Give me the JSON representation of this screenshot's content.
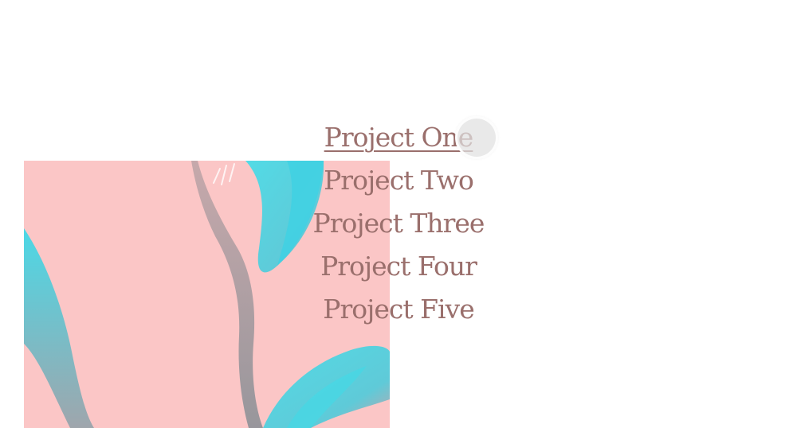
{
  "menu": {
    "items": [
      {
        "label": "Project One",
        "active": true
      },
      {
        "label": "Project Two",
        "active": false
      },
      {
        "label": "Project Three",
        "active": false
      },
      {
        "label": "Project Four",
        "active": false
      },
      {
        "label": "Project Five",
        "active": false
      }
    ]
  },
  "colors": {
    "text": "#9a6f6c",
    "image_background": "#fbc6c6",
    "leaf_cyan": "#4fd6e3",
    "leaf_grey": "#9aa0a6"
  },
  "icons": {
    "cursor": "cursor-ring-icon"
  }
}
